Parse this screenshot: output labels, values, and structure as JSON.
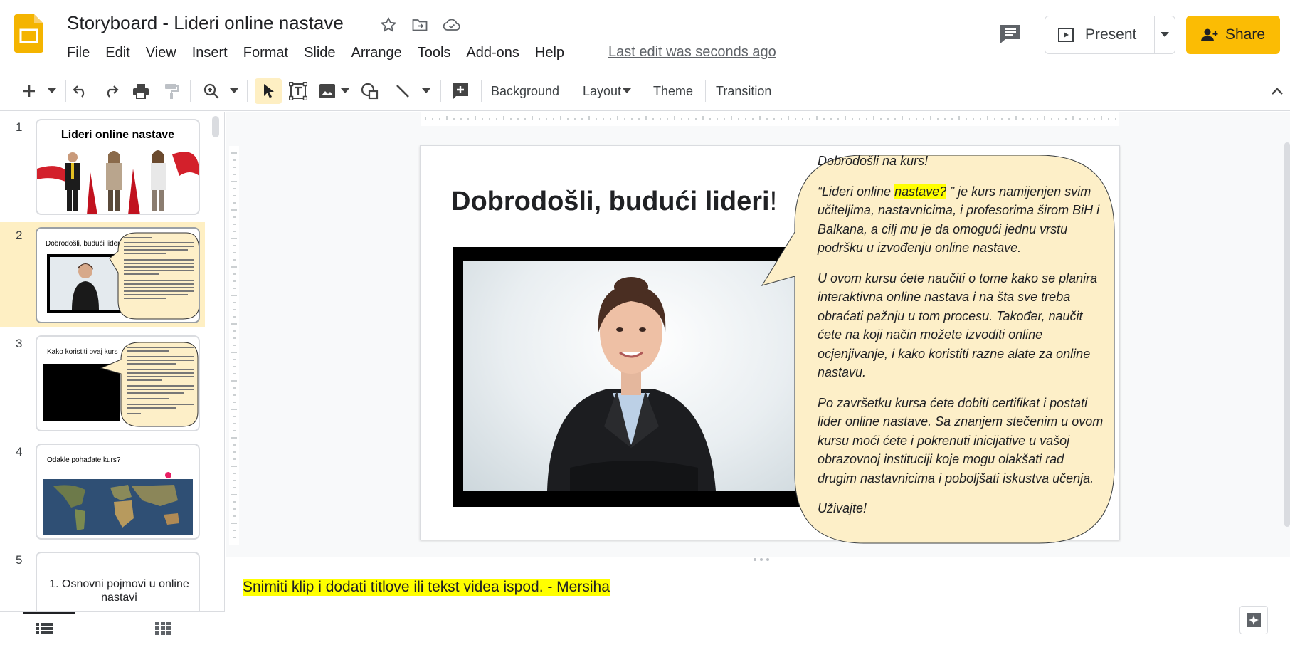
{
  "header": {
    "doc_title": "Storyboard - Lideri online nastave",
    "last_edit": "Last edit was seconds ago",
    "present_label": "Present",
    "share_label": "Share"
  },
  "menu": [
    "File",
    "Edit",
    "View",
    "Insert",
    "Format",
    "Slide",
    "Arrange",
    "Tools",
    "Add-ons",
    "Help"
  ],
  "toolbar": {
    "background_label": "Background",
    "layout_label": "Layout",
    "theme_label": "Theme",
    "transition_label": "Transition"
  },
  "filmstrip": {
    "selected_slide": 2,
    "slides": [
      {
        "number": "1",
        "title": "Lideri online nastave"
      },
      {
        "number": "2",
        "title": "Dobrodošli, budući lideri!"
      },
      {
        "number": "3",
        "title": "Kako koristiti ovaj kurs"
      },
      {
        "number": "4",
        "title": "Odakle pohađate kurs?"
      },
      {
        "number": "5",
        "title": "1. Osnovni pojmovi u online nastavi"
      }
    ]
  },
  "slide": {
    "heading": "Dobrodošli, budući lideri",
    "heading_suffix": "!",
    "callout": {
      "greeting": "Dobrodošli na kurs!",
      "p1_a": "“Lideri online ",
      "p1_highlight": "nastave?",
      "p1_b": " ” je kurs namijenjen svim učiteljima, nastavnicima, i profesorima širom BiH i Balkana, a cilj mu je da omogući jednu vrstu podršku u izvođenju online nastave.",
      "p2": "U ovom kursu ćete naučiti o tome kako se planira interaktivna online nastava i na šta sve treba obraćati pažnju u tom procesu. Također, naučit ćete na koji način možete izvoditi online ocjenjivanje, i kako koristiti razne alate za online nastavu.",
      "p3": "Po završetku kursa ćete dobiti certifikat i postati lider online nastave. Sa znanjem stečenim u ovom kursu moći ćete i pokrenuti inicijative u vašoj obrazovnoj instituciji koje mogu olakšati rad drugim nastavnicima i poboljšati iskustva učenja.",
      "closing": "Uživajte!"
    }
  },
  "notes": {
    "text": "Snimiti klip i dodati titlove ili tekst videa ispod. - Mersiha"
  },
  "colors": {
    "accent": "#fbbc04",
    "selected_slide_bg": "#feefc3",
    "callout_fill": "#fdefc8",
    "highlight": "#ffff00"
  }
}
